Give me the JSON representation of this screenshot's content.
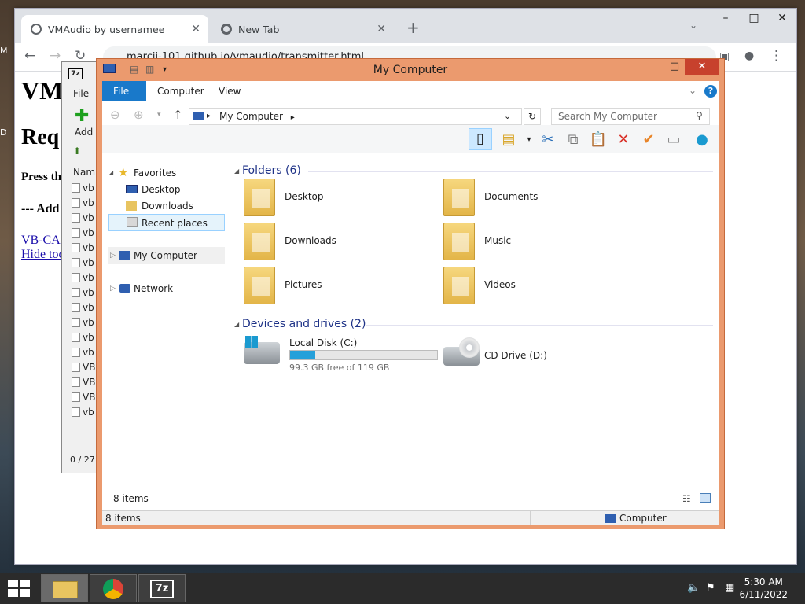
{
  "desktop": {
    "edge_top": "M",
    "edge_mid": "D"
  },
  "chrome": {
    "tabs": [
      {
        "title": "VMAudio by usernamee"
      },
      {
        "title": "New Tab"
      }
    ],
    "url": "marcij-101.github.io/vmaudio/transmitter.html",
    "page": {
      "h1": "VM",
      "h2": "Req",
      "press": "Press th",
      "add": "--- Add",
      "link1": "VB-CA",
      "link2": "Hide too"
    }
  },
  "sevenzip": {
    "menu_file": "File",
    "add_label": "Add",
    "col_name": "Nam",
    "rows": [
      "vb",
      "vb",
      "vb",
      "vb",
      "vb",
      "vb",
      "vb",
      "vb",
      "vb",
      "vb",
      "vb",
      "vb",
      "VB",
      "VB",
      "VB",
      "vb"
    ],
    "status": "0 / 27"
  },
  "explorer": {
    "title": "My Computer",
    "ribbon_tabs": [
      "File",
      "Computer",
      "View"
    ],
    "address": "My Computer",
    "search_placeholder": "Search My Computer",
    "nav": {
      "favorites": "Favorites",
      "desktop": "Desktop",
      "downloads": "Downloads",
      "recent": "Recent places",
      "computer": "My Computer",
      "network": "Network"
    },
    "groups": {
      "folders": "Folders (6)",
      "drives": "Devices and drives (2)"
    },
    "folders": [
      "Desktop",
      "Documents",
      "Downloads",
      "Music",
      "Pictures",
      "Videos"
    ],
    "drives": [
      {
        "name": "Local Disk (C:)",
        "free": "99.3 GB free of 119 GB",
        "used_fraction": 0.17
      },
      {
        "name": "CD Drive (D:)"
      }
    ],
    "item_count": "8 items",
    "status_count": "8 items",
    "status_location": "Computer"
  },
  "taskbar": {
    "time": "5:30 AM",
    "date": "6/11/2022",
    "sevenzip_label": "7z"
  },
  "colors": {
    "explorer_frame": "#eb9a6e",
    "ribbon_file": "#1979ca",
    "group_text": "#1e3287",
    "drive_bar": "#26a0da"
  }
}
